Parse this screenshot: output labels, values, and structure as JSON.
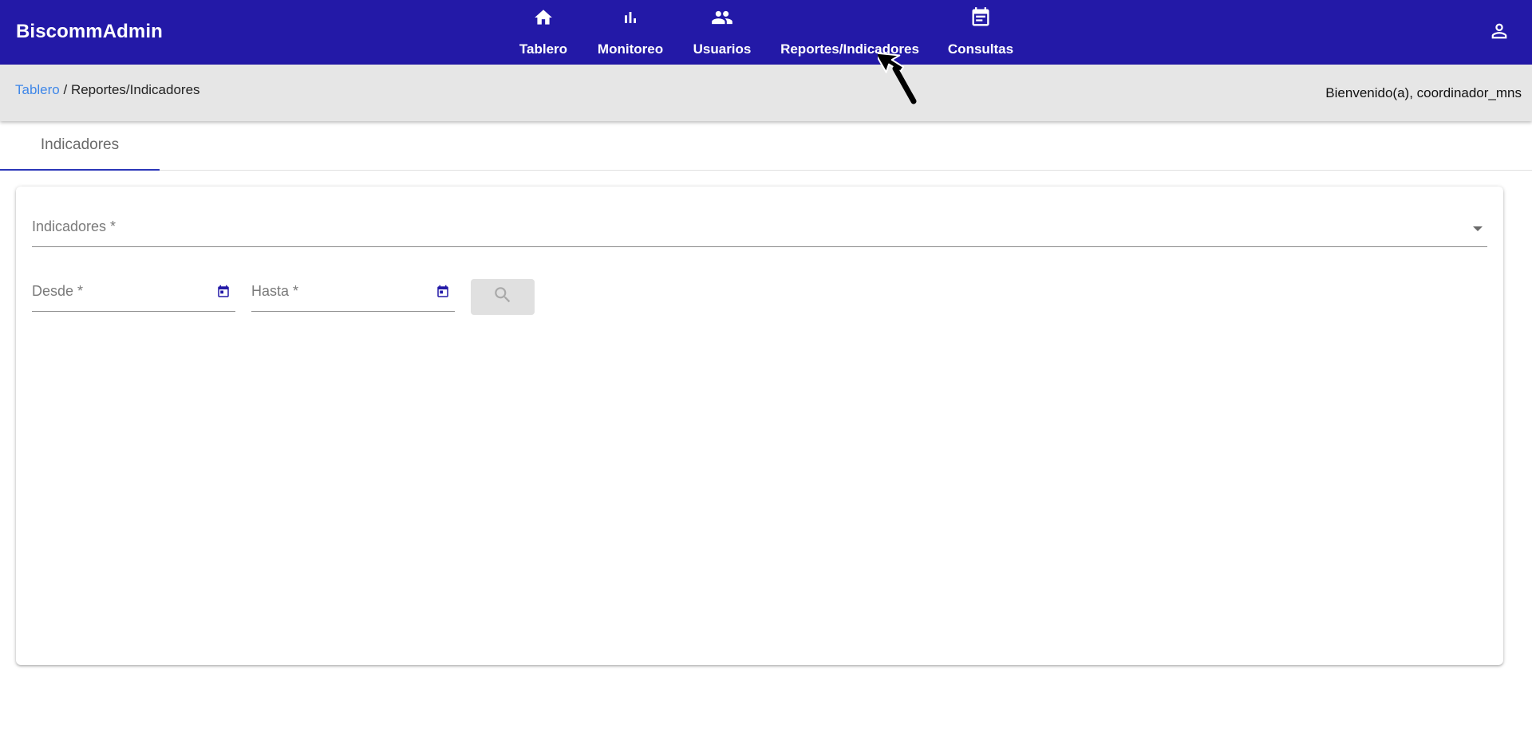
{
  "app": {
    "title": "BiscommAdmin"
  },
  "nav": {
    "items": [
      {
        "label": "Tablero",
        "icon": "home-icon"
      },
      {
        "label": "Monitoreo",
        "icon": "bar-chart-icon"
      },
      {
        "label": "Usuarios",
        "icon": "people-icon"
      },
      {
        "label": "Reportes/Indicadores",
        "icon": ""
      },
      {
        "label": "Consultas",
        "icon": "calendar-note-icon"
      }
    ],
    "account_icon": "person-icon"
  },
  "breadcrumb": {
    "link": "Tablero",
    "separator": " / ",
    "current": "Reportes/Indicadores"
  },
  "welcome": "Bienvenido(a), coordinador_mns",
  "tabs": [
    {
      "label": "Indicadores",
      "active": true
    }
  ],
  "form": {
    "indicadores_label": "Indicadores *",
    "desde_label": "Desde *",
    "hasta_label": "Hasta *",
    "search_icon": "search-icon",
    "search_disabled": true
  },
  "colors": {
    "toolbar": "#2319a7",
    "breadcrumb_bar": "#e6e6e6",
    "link": "#3f87e8",
    "tab_indicator": "#2b37b8",
    "calendar_icon": "#2319a7"
  }
}
